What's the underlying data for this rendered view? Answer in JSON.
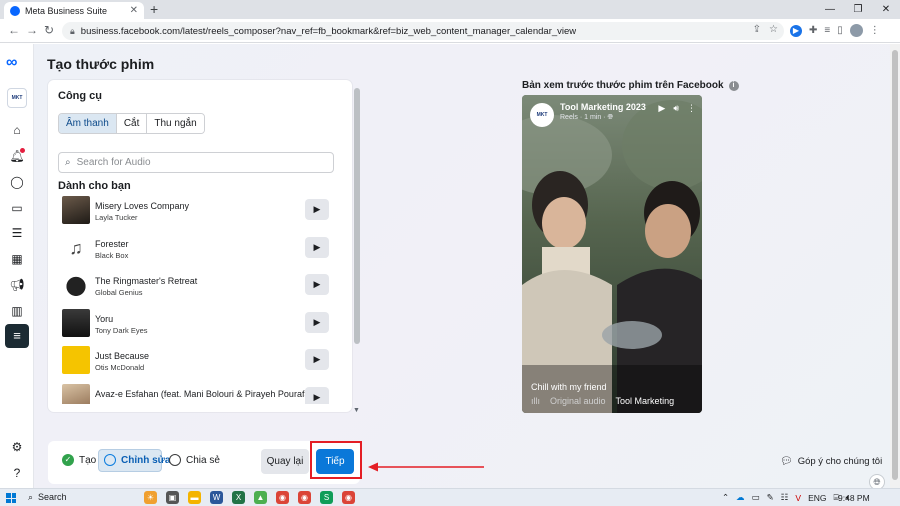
{
  "browser": {
    "tab_title": "Meta Business Suite",
    "url": "business.facebook.com/latest/reels_composer?nav_ref=fb_bookmark&ref=biz_web_content_manager_calendar_view"
  },
  "page": {
    "title": "Tạo thước phim"
  },
  "tools": {
    "heading": "Công cụ",
    "tabs": [
      "Âm thanh",
      "Cắt",
      "Thu ngắn"
    ],
    "search_placeholder": "Search for Audio",
    "section_label": "Dành cho bạn",
    "tracks": [
      {
        "title": "Misery Loves Company",
        "artist": "Layla Tucker"
      },
      {
        "title": "Forester",
        "artist": "Black Box"
      },
      {
        "title": "The Ringmaster's Retreat",
        "artist": "Global Genius"
      },
      {
        "title": "Yoru",
        "artist": "Tony Dark Eyes"
      },
      {
        "title": "Just Because",
        "artist": "Otis McDonald"
      },
      {
        "title": "Avaz-e Esfahan (feat. Mani Bolouri & Pirayeh Pourafar)",
        "artist": ""
      }
    ]
  },
  "preview": {
    "title": "Bản xem trước thước phim trên Facebook",
    "page_name": "Tool Marketing 2023",
    "meta": "Reels · 1 min ·",
    "caption": "Chill with my friend",
    "audio_label": "Original audio",
    "audio_owner": "Tool Marketing",
    "avatar_text": "MKT"
  },
  "steps": {
    "create": "Tạo",
    "edit": "Chỉnh sửa",
    "share": "Chia sẻ"
  },
  "buttons": {
    "back": "Quay lại",
    "next": "Tiếp"
  },
  "feedback": "Góp ý cho chúng tôi",
  "taskbar": {
    "search": "Search",
    "lang": "ENG",
    "time": "9:48 PM"
  },
  "colors": {
    "accent": "#0a78d9",
    "highlight": "#e41e25",
    "success": "#31a24c"
  }
}
